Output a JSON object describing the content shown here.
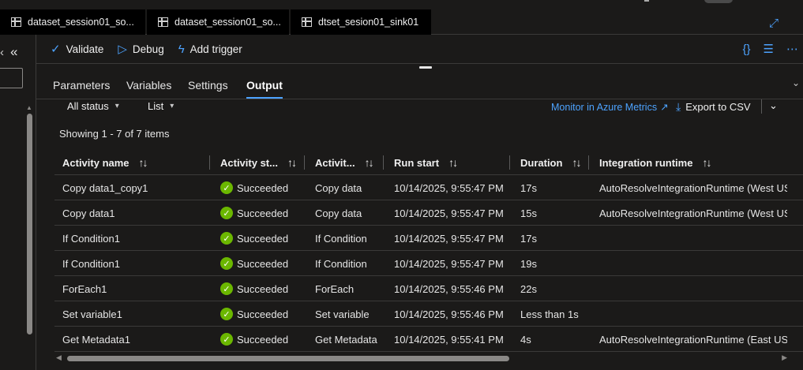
{
  "tabs": [
    {
      "label": "dataset_session01_so..."
    },
    {
      "label": "dataset_session01_so..."
    },
    {
      "label": "dtset_sesion01_sink01"
    }
  ],
  "toolbar": {
    "validate": "Validate",
    "debug": "Debug",
    "add_trigger": "Add trigger"
  },
  "panel_tabs": [
    "Parameters",
    "Variables",
    "Settings",
    "Output"
  ],
  "active_panel_tab": "Output",
  "filters": {
    "status": "All status",
    "view": "List",
    "monitor_link": "Monitor in Azure Metrics",
    "export": "Export to CSV"
  },
  "showing_text": "Showing 1 - 7 of 7 items",
  "table": {
    "columns": [
      "Activity name",
      "Activity st...",
      "Activit...",
      "Run start",
      "Duration",
      "Integration runtime"
    ],
    "rows": [
      {
        "name": "Copy data1_copy1",
        "status": "Succeeded",
        "type": "Copy data",
        "run_start": "10/14/2025, 9:55:47 PM",
        "duration": "17s",
        "runtime": "AutoResolveIntegrationRuntime (West US"
      },
      {
        "name": "Copy data1",
        "status": "Succeeded",
        "type": "Copy data",
        "run_start": "10/14/2025, 9:55:47 PM",
        "duration": "15s",
        "runtime": "AutoResolveIntegrationRuntime (West US"
      },
      {
        "name": "If Condition1",
        "status": "Succeeded",
        "type": "If Condition",
        "run_start": "10/14/2025, 9:55:47 PM",
        "duration": "17s",
        "runtime": ""
      },
      {
        "name": "If Condition1",
        "status": "Succeeded",
        "type": "If Condition",
        "run_start": "10/14/2025, 9:55:47 PM",
        "duration": "19s",
        "runtime": ""
      },
      {
        "name": "ForEach1",
        "status": "Succeeded",
        "type": "ForEach",
        "run_start": "10/14/2025, 9:55:46 PM",
        "duration": "22s",
        "runtime": ""
      },
      {
        "name": "Set variable1",
        "status": "Succeeded",
        "type": "Set variable",
        "run_start": "10/14/2025, 9:55:46 PM",
        "duration": "Less than 1s",
        "runtime": ""
      },
      {
        "name": "Get Metadata1",
        "status": "Succeeded",
        "type": "Get Metadata",
        "run_start": "10/14/2025, 9:55:41 PM",
        "duration": "4s",
        "runtime": "AutoResolveIntegrationRuntime (East US)"
      }
    ]
  },
  "colors": {
    "accent": "#4da3ff",
    "success": "#6bb700",
    "background": "#1b1a19"
  },
  "icons": [
    "table-icon",
    "checkmark-icon",
    "debug-play-icon",
    "add-trigger-icon",
    "code-braces-icon",
    "properties-icon",
    "more-icon",
    "external-link-icon",
    "download-icon",
    "sort-icon",
    "succeeded-icon"
  ]
}
